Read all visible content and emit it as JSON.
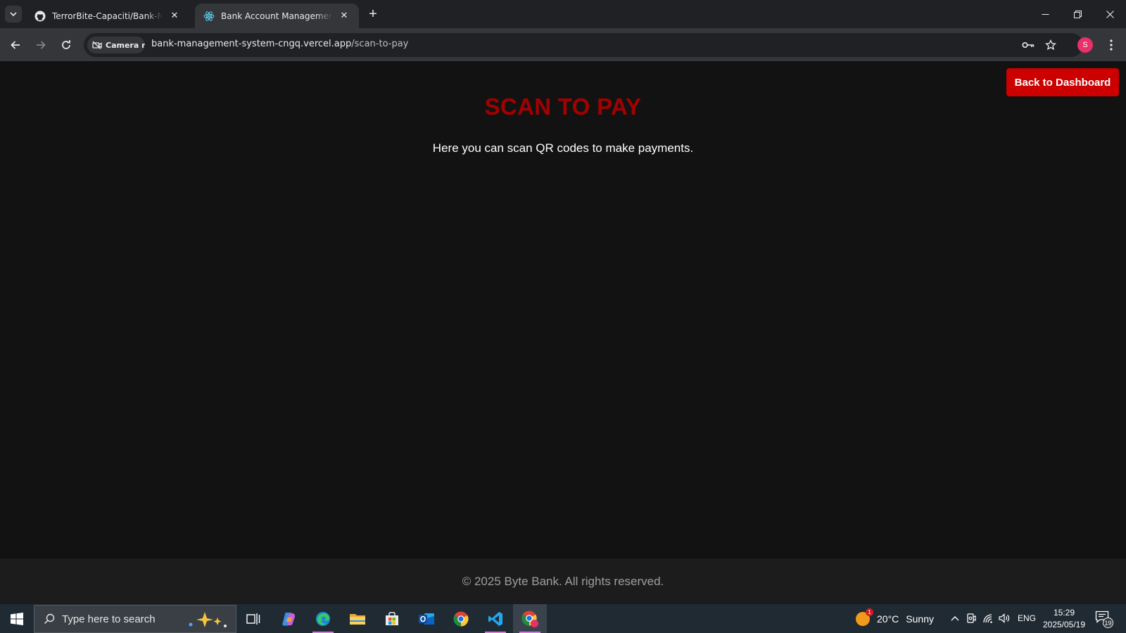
{
  "browser": {
    "tabs": [
      {
        "title": "TerrorBite-Capaciti/Bank-Manag",
        "favicon": "github-icon",
        "active": false
      },
      {
        "title": "Bank Account Management Sys",
        "favicon": "react-icon",
        "active": true
      }
    ],
    "site_chip": "Camera n",
    "url_host": "bank-management-system-cngq.vercel.app",
    "url_path": "/scan-to-pay",
    "profile_initial": "S"
  },
  "page": {
    "back_button": "Back to Dashboard",
    "heading": "SCAN TO PAY",
    "intro": "Here you can scan QR codes to make payments.",
    "footer": "© 2025 Byte Bank. All rights reserved.",
    "accent_color": "#cc0000",
    "heading_color": "#a30000"
  },
  "taskbar": {
    "search_placeholder": "Type here to search",
    "weather_temp": "20°C",
    "weather_condition": "Sunny",
    "weather_badge": "1",
    "language": "ENG",
    "time": "15:29",
    "date": "2025/05/19",
    "notification_count": "19",
    "apps": [
      "task-view-icon",
      "copilot-icon",
      "edge-icon",
      "file-explorer-icon",
      "store-icon",
      "outlook-icon",
      "chrome-icon",
      "vscode-icon",
      "chrome-profile-icon"
    ]
  }
}
